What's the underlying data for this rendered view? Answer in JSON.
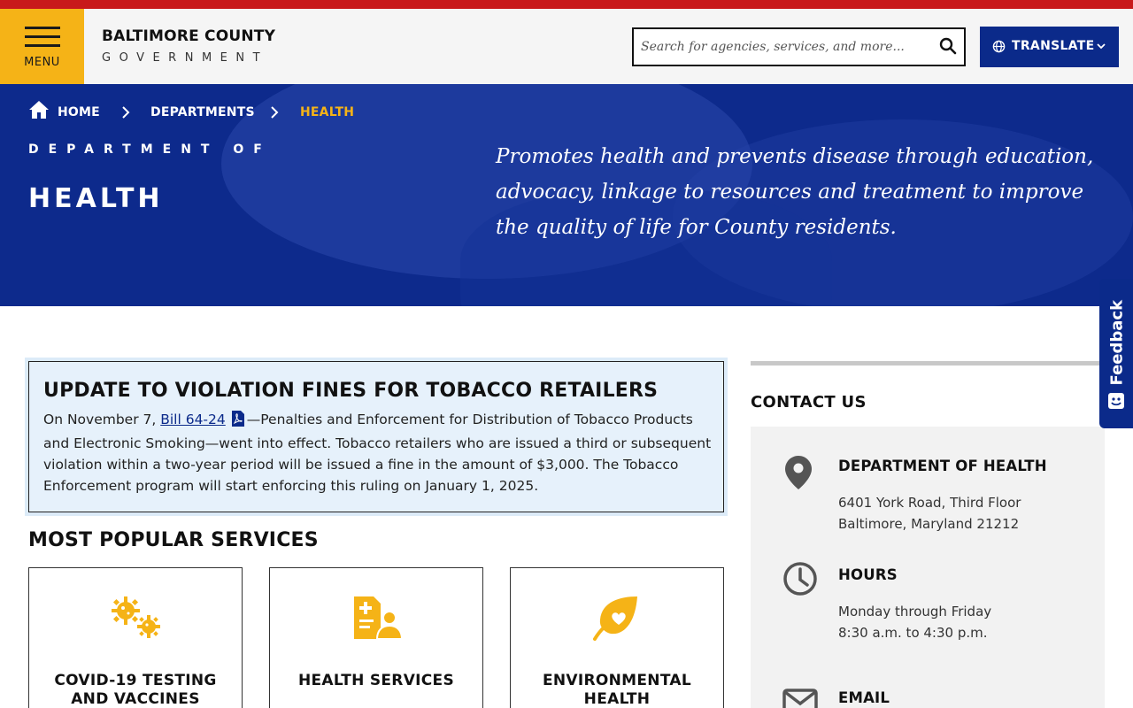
{
  "header": {
    "menu_label": "MENU",
    "logo_title": "BALTIMORE COUNTY",
    "logo_subtitle": "GOVERNMENT",
    "search_placeholder": "Search for agencies, services, and more...",
    "translate_label": "TRANSLATE"
  },
  "breadcrumb": {
    "home": "HOME",
    "departments": "DEPARTMENTS",
    "current": "HEALTH"
  },
  "hero": {
    "dept_of": "DEPARTMENT OF",
    "dept_name": "HEALTH",
    "mission": "Promotes health and prevents disease through education, advocacy, linkage to resources and treatment to improve the quality of life for County residents."
  },
  "alert": {
    "title": "UPDATE TO VIOLATION FINES FOR TOBACCO RETAILERS",
    "text_before": "On November 7, ",
    "link_text": "Bill 64-24",
    "text_after": "—Penalties and Enforcement for Distribution of Tobacco Products and Electronic Smoking—went into effect. Tobacco retailers who are issued a third or subsequent violation within a two-year period will be issued a fine in the amount of $3,000. The Tobacco Enforcement program will start enforcing this ruling on January 1, 2025."
  },
  "popular": {
    "title": "MOST POPULAR SERVICES",
    "cards": [
      {
        "label_line1": "COVID-19 TESTING",
        "label_line2": "AND VACCINES",
        "icon": "virus-icon"
      },
      {
        "label_line1": "HEALTH SERVICES",
        "label_line2": "",
        "icon": "medical-file-person-icon"
      },
      {
        "label_line1": "ENVIRONMENTAL",
        "label_line2": "HEALTH",
        "icon": "leaf-heart-icon"
      }
    ]
  },
  "contact": {
    "title": "CONTACT US",
    "dept_name": "DEPARTMENT OF HEALTH",
    "address_line1": "6401 York Road, Third Floor",
    "address_line2": "Baltimore, Maryland 21212",
    "hours_title": "HOURS",
    "hours_line1": "Monday through Friday",
    "hours_line2": "8:30 a.m. to 4:30 p.m.",
    "email_title": "EMAIL"
  },
  "feedback": {
    "label": "Feedback"
  },
  "colors": {
    "top_bar": "#c8191b",
    "menu_gold": "#f5b317",
    "brand_blue": "#0b2a8a",
    "hero_blue": "#0d2a8c",
    "alert_bg": "#e6f1fb",
    "contact_bg": "#f2f2f2"
  }
}
